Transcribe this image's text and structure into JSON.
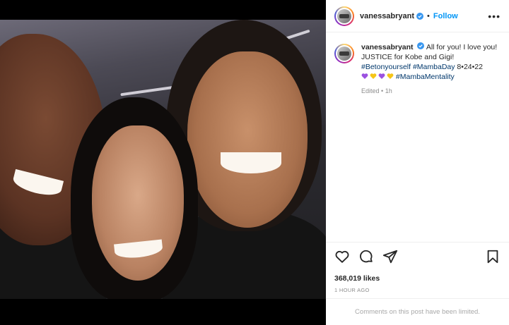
{
  "post": {
    "username": "vanessabryant",
    "follow_label": "Follow",
    "more_label": "•••",
    "dot": "•",
    "caption_text": "All for you! I love you! JUSTICE for Kobe and Gigi!",
    "caption_tag1": "#Betonyourself",
    "caption_tag2": "#MambaDay",
    "caption_date": "8•24•22",
    "caption_tag3": "#MambaMentality",
    "hearts": [
      "purple-heart-icon",
      "yellow-heart-icon",
      "purple-heart-icon",
      "yellow-heart-icon"
    ],
    "heart_colors": {
      "purple": "#9b51e0",
      "yellow": "#f5c518"
    },
    "edited_label": "Edited",
    "edited_time": "1h",
    "likes": "368,019 likes",
    "timestamp": "1 HOUR AGO",
    "comments_limited": "Comments on this post have been limited."
  },
  "colors": {
    "accent": "#0095f6",
    "hashtag": "#00376b",
    "muted": "#8e8e8e"
  },
  "icons": {
    "like": "heart-outline-icon",
    "comment": "comment-bubble-icon",
    "share": "paper-plane-icon",
    "save": "bookmark-icon"
  }
}
